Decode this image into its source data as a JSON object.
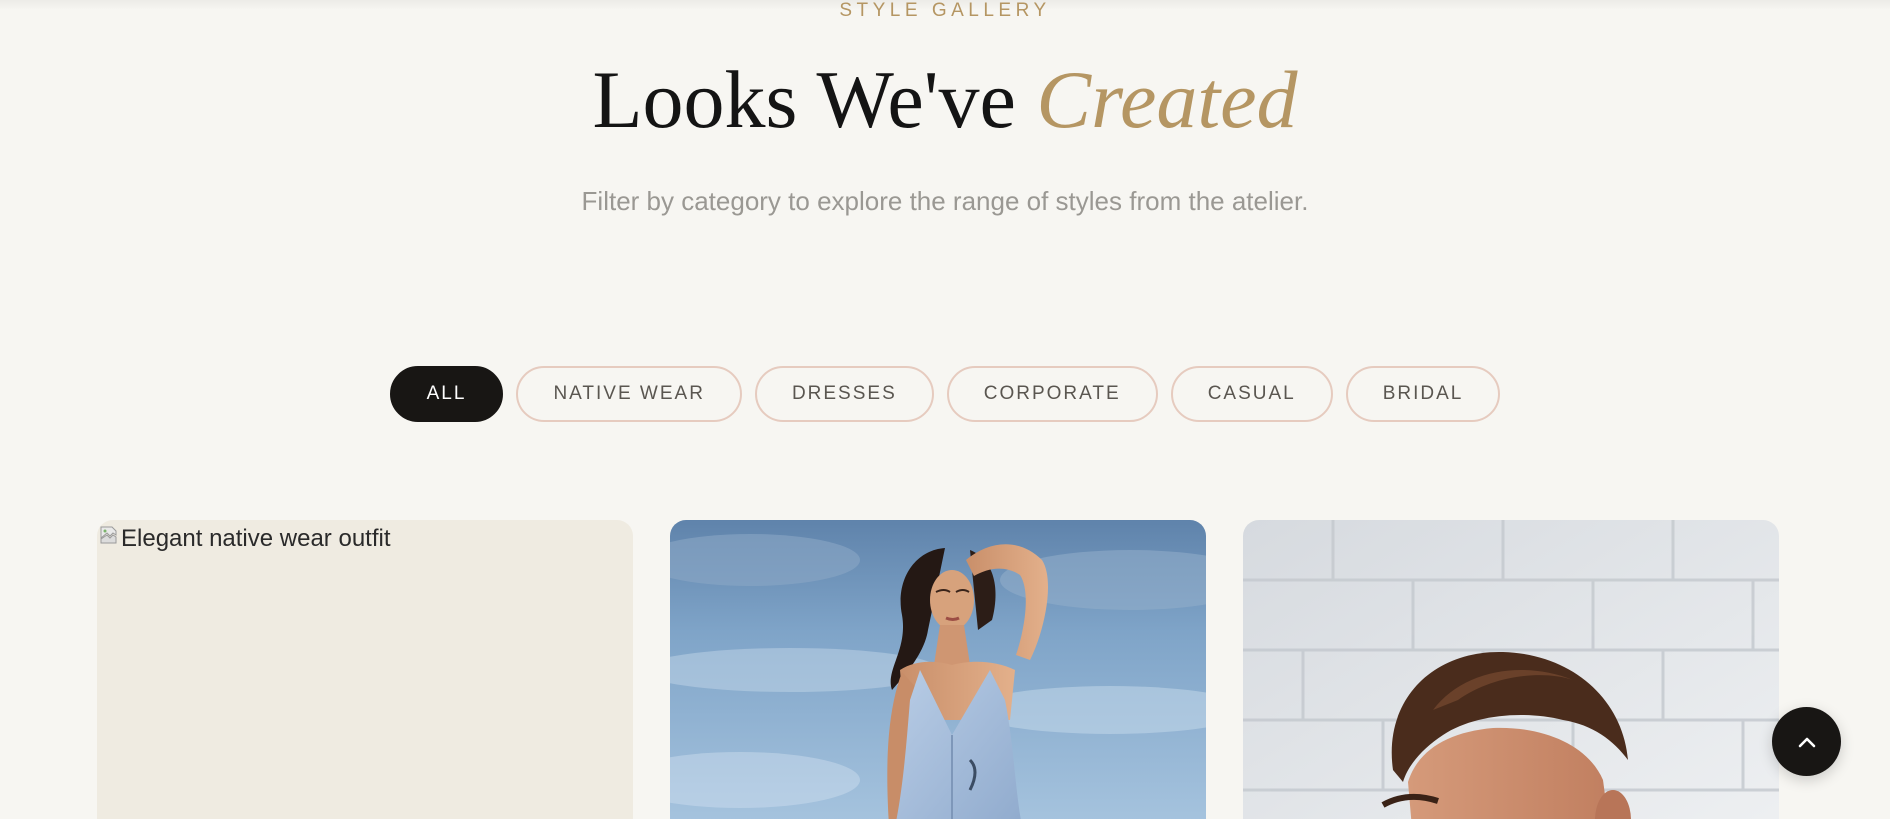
{
  "header": {
    "eyebrow": "STYLE GALLERY",
    "title_main": "Looks We've",
    "title_accent": "Created",
    "subtitle": "Filter by category to explore the range of styles from the atelier."
  },
  "filters": {
    "items": [
      {
        "label": "ALL",
        "active": true
      },
      {
        "label": "NATIVE WEAR",
        "active": false
      },
      {
        "label": "DRESSES",
        "active": false
      },
      {
        "label": "CORPORATE",
        "active": false
      },
      {
        "label": "CASUAL",
        "active": false
      },
      {
        "label": "BRIDAL",
        "active": false
      }
    ]
  },
  "gallery": {
    "cards": [
      {
        "alt": "Elegant native wear outfit",
        "broken": true
      },
      {
        "alt": "",
        "broken": false
      },
      {
        "alt": "",
        "broken": false
      }
    ]
  },
  "scroll_top": {
    "icon": "chevron-up-icon"
  },
  "colors": {
    "accent": "#b59663",
    "background": "#f7f6f2",
    "dark": "#181614",
    "chip_border": "#e6cbbf"
  }
}
